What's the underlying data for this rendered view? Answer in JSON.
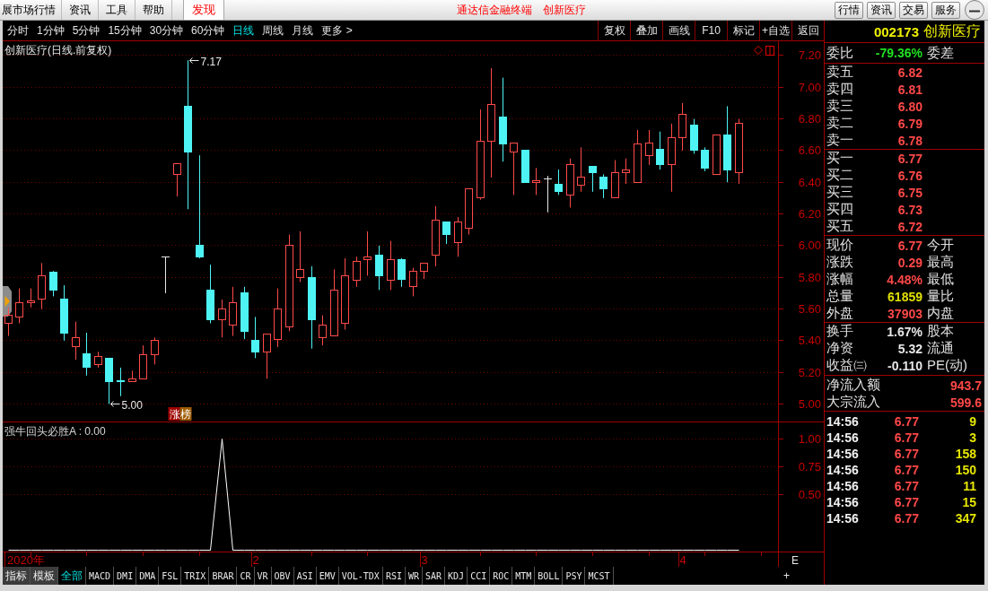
{
  "menubar": {
    "items": [
      "展市场行情",
      "资讯",
      "工具",
      "帮助"
    ],
    "discover": "发现",
    "titles": [
      "通达信金融终端",
      "创新医疗"
    ],
    "buttons": [
      "行情",
      "资讯",
      "交易",
      "服务"
    ]
  },
  "toolbar": {
    "periods": [
      {
        "label": "分时",
        "selected": false
      },
      {
        "label": "1分钟",
        "selected": false
      },
      {
        "label": "5分钟",
        "selected": false
      },
      {
        "label": "15分钟",
        "selected": false
      },
      {
        "label": "30分钟",
        "selected": false
      },
      {
        "label": "60分钟",
        "selected": false
      },
      {
        "label": "日线",
        "selected": true
      },
      {
        "label": "周线",
        "selected": false
      },
      {
        "label": "月线",
        "selected": false
      },
      {
        "label": "更多 >",
        "selected": false
      }
    ],
    "actions": [
      "复权",
      "叠加",
      "画线",
      "F10",
      "标记",
      "+自选",
      "返回"
    ]
  },
  "main_chart": {
    "chart_data": [
      {
        "type": "candlestick",
        "title": "创新医疗(日线.前复权)",
        "ylim": [
          4.89,
          7.29
        ],
        "yticks": [
          {
            "value": 5.0,
            "label": "5.00"
          },
          {
            "value": 5.2,
            "label": "5.20"
          },
          {
            "value": 5.4,
            "label": "5.40"
          },
          {
            "value": 5.6,
            "label": "5.60"
          },
          {
            "value": 5.8,
            "label": "5.80"
          },
          {
            "value": 6.0,
            "label": "6.00"
          },
          {
            "value": 6.2,
            "label": "6.20"
          },
          {
            "value": 6.4,
            "label": "6.40"
          },
          {
            "value": 6.6,
            "label": "6.60"
          },
          {
            "value": 6.8,
            "label": "6.80"
          },
          {
            "value": 7.0,
            "label": "7.00"
          },
          {
            "value": 7.2,
            "label": "7.20"
          }
        ],
        "grid": true,
        "annotations": [
          "7.17",
          "5.00",
          "涨榜"
        ],
        "ohlc": [
          [
            5.51,
            5.61,
            5.43,
            5.56
          ],
          [
            5.55,
            5.73,
            5.51,
            5.64
          ],
          [
            5.64,
            5.73,
            5.61,
            5.65
          ],
          [
            5.66,
            5.89,
            5.6,
            5.81
          ],
          [
            5.83,
            5.84,
            5.68,
            5.72
          ],
          [
            5.66,
            5.75,
            5.4,
            5.45
          ],
          [
            5.36,
            5.52,
            5.28,
            5.42
          ],
          [
            5.32,
            5.45,
            5.18,
            5.23
          ],
          [
            5.25,
            5.33,
            5.23,
            5.3
          ],
          [
            5.29,
            5.29,
            5.0,
            5.14
          ],
          [
            5.15,
            5.23,
            5.05,
            5.14
          ],
          [
            5.14,
            5.21,
            5.14,
            5.16
          ],
          [
            5.16,
            5.37,
            5.16,
            5.31
          ],
          [
            5.31,
            5.42,
            5.25,
            5.4
          ],
          [
            5.93,
            5.93,
            5.7,
            5.93
          ],
          [
            6.45,
            6.52,
            6.31,
            6.52
          ],
          [
            6.88,
            7.17,
            6.23,
            6.59
          ],
          [
            6.0,
            6.57,
            5.92,
            5.93
          ],
          [
            5.72,
            5.88,
            5.51,
            5.53
          ],
          [
            5.53,
            5.66,
            5.42,
            5.6
          ],
          [
            5.5,
            5.74,
            5.43,
            5.64
          ],
          [
            5.7,
            5.74,
            5.41,
            5.46
          ],
          [
            5.4,
            5.55,
            5.29,
            5.33
          ],
          [
            5.33,
            5.44,
            5.16,
            5.44
          ],
          [
            5.41,
            5.73,
            5.36,
            5.6
          ],
          [
            5.49,
            6.07,
            5.46,
            6.0
          ],
          [
            5.8,
            6.09,
            5.77,
            5.85
          ],
          [
            5.8,
            5.87,
            5.35,
            5.53
          ],
          [
            5.42,
            5.56,
            5.37,
            5.5
          ],
          [
            5.43,
            5.85,
            5.43,
            5.72
          ],
          [
            5.51,
            5.92,
            5.47,
            5.81
          ],
          [
            5.78,
            5.93,
            5.74,
            5.9
          ],
          [
            5.91,
            6.09,
            5.81,
            5.93
          ],
          [
            5.94,
            6.0,
            5.72,
            5.81
          ],
          [
            5.78,
            6.03,
            5.72,
            5.91
          ],
          [
            5.91,
            5.92,
            5.74,
            5.79
          ],
          [
            5.74,
            5.86,
            5.68,
            5.84
          ],
          [
            5.84,
            5.89,
            5.79,
            5.89
          ],
          [
            5.94,
            6.25,
            5.87,
            6.16
          ],
          [
            6.15,
            6.15,
            6.01,
            6.07
          ],
          [
            6.02,
            6.18,
            5.93,
            6.15
          ],
          [
            6.11,
            6.36,
            6.07,
            6.36
          ],
          [
            6.3,
            6.86,
            6.29,
            6.66
          ],
          [
            6.66,
            7.12,
            6.43,
            6.89
          ],
          [
            6.81,
            7.06,
            6.53,
            6.64
          ],
          [
            6.59,
            6.65,
            6.32,
            6.65
          ],
          [
            6.6,
            6.6,
            6.4,
            6.4
          ],
          [
            6.4,
            6.49,
            6.32,
            6.41
          ],
          [
            6.42,
            6.44,
            6.21,
            6.42
          ],
          [
            6.39,
            6.48,
            6.32,
            6.34
          ],
          [
            6.32,
            6.55,
            6.24,
            6.51
          ],
          [
            6.38,
            6.62,
            6.34,
            6.43
          ],
          [
            6.5,
            6.5,
            6.34,
            6.46
          ],
          [
            6.43,
            6.45,
            6.3,
            6.36
          ],
          [
            6.3,
            6.54,
            6.3,
            6.46
          ],
          [
            6.46,
            6.55,
            6.39,
            6.48
          ],
          [
            6.4,
            6.73,
            6.4,
            6.64
          ],
          [
            6.57,
            6.73,
            6.51,
            6.65
          ],
          [
            6.61,
            6.72,
            6.48,
            6.51
          ],
          [
            6.51,
            6.77,
            6.34,
            6.68
          ],
          [
            6.68,
            6.9,
            6.6,
            6.83
          ],
          [
            6.76,
            6.8,
            6.58,
            6.6
          ],
          [
            6.6,
            6.62,
            6.47,
            6.49
          ],
          [
            6.45,
            6.7,
            6.45,
            6.7
          ],
          [
            6.7,
            6.88,
            6.4,
            6.48
          ],
          [
            6.46,
            6.8,
            6.39,
            6.77
          ],
          null,
          null,
          null
        ]
      }
    ]
  },
  "indicator_chart": {
    "chart_data": [
      {
        "type": "line",
        "title": "强牛回头必胜A : 0.00",
        "color": "#ffffff",
        "grid": true,
        "ylim": [
          -0.0121,
          1.1573
        ],
        "yticks": [
          {
            "value": 0.5,
            "label": "0.50"
          },
          {
            "value": 0.75,
            "label": "0.75"
          },
          {
            "value": 1.0,
            "label": "1.00"
          }
        ],
        "categories": [
          null,
          null,
          null,
          null,
          null,
          null,
          null,
          null,
          null,
          null,
          null,
          null,
          null,
          null,
          null,
          null,
          null,
          null,
          null,
          null,
          null,
          null,
          "2",
          null,
          null,
          null,
          null,
          null,
          null,
          null,
          null,
          null,
          null,
          null,
          null,
          null,
          null,
          "3",
          null,
          null,
          null,
          null,
          null,
          null,
          null,
          null,
          null,
          null,
          null,
          null,
          null,
          null,
          null,
          null,
          null,
          null,
          null,
          null,
          null,
          null,
          "4",
          null,
          null,
          null,
          null,
          null,
          null,
          null,
          null
        ],
        "values": [
          0,
          0,
          0,
          0,
          0,
          0,
          0,
          0,
          0,
          0,
          0,
          0,
          0,
          0,
          0,
          0,
          0,
          0,
          0,
          1,
          0,
          0,
          0,
          0,
          0,
          0,
          0,
          0,
          0,
          0,
          0,
          0,
          0,
          0,
          0,
          0,
          0,
          0,
          0,
          0,
          0,
          0,
          0,
          0,
          0,
          0,
          0,
          0,
          0,
          0,
          0,
          0,
          0,
          0,
          0,
          0,
          0,
          0,
          0,
          0,
          0,
          0,
          0,
          0,
          0,
          0,
          null,
          null,
          null
        ]
      }
    ],
    "year_label": "2020年",
    "corner_label": "E"
  },
  "indicator_bar": {
    "tabs": [
      {
        "label": "指标",
        "kind": "menu",
        "selected": false
      },
      {
        "label": "模板",
        "kind": "menu",
        "selected": false
      },
      {
        "label": "全部",
        "kind": "tab",
        "selected": true
      },
      {
        "label": "MACD",
        "kind": "tab",
        "selected": false
      },
      {
        "label": "DMI",
        "kind": "tab",
        "selected": false
      },
      {
        "label": "DMA",
        "kind": "tab",
        "selected": false
      },
      {
        "label": "FSL",
        "kind": "tab",
        "selected": false
      },
      {
        "label": "TRIX",
        "kind": "tab",
        "selected": false
      },
      {
        "label": "BRAR",
        "kind": "tab",
        "selected": false
      },
      {
        "label": "CR",
        "kind": "tab",
        "selected": false
      },
      {
        "label": "VR",
        "kind": "tab",
        "selected": false
      },
      {
        "label": "OBV",
        "kind": "tab",
        "selected": false
      },
      {
        "label": "ASI",
        "kind": "tab",
        "selected": false
      },
      {
        "label": "EMV",
        "kind": "tab",
        "selected": false
      },
      {
        "label": "VOL-TDX",
        "kind": "tab",
        "selected": false
      },
      {
        "label": "RSI",
        "kind": "tab",
        "selected": false
      },
      {
        "label": "WR",
        "kind": "tab",
        "selected": false
      },
      {
        "label": "SAR",
        "kind": "tab",
        "selected": false
      },
      {
        "label": "KDJ",
        "kind": "tab",
        "selected": false
      },
      {
        "label": "CCI",
        "kind": "tab",
        "selected": false
      },
      {
        "label": "ROC",
        "kind": "tab",
        "selected": false
      },
      {
        "label": "MTM",
        "kind": "tab",
        "selected": false
      },
      {
        "label": "BOLL",
        "kind": "tab",
        "selected": false
      },
      {
        "label": "PSY",
        "kind": "tab",
        "selected": false
      },
      {
        "label": "MCST",
        "kind": "tab",
        "selected": false
      }
    ],
    "add_button": "+"
  },
  "quote_panel": {
    "code": "002173",
    "name": "创新医疗",
    "summary": [
      {
        "label": "委比",
        "value": "-79.36%",
        "color": "#20e020",
        "label2": "委差"
      }
    ],
    "asks": [
      {
        "label": "卖五",
        "value": "6.82",
        "color": "#ff4848"
      },
      {
        "label": "卖四",
        "value": "6.81",
        "color": "#ff4848"
      },
      {
        "label": "卖三",
        "value": "6.80",
        "color": "#ff4848"
      },
      {
        "label": "卖二",
        "value": "6.79",
        "color": "#ff4848"
      },
      {
        "label": "卖一",
        "value": "6.78",
        "color": "#ff4848"
      }
    ],
    "bids": [
      {
        "label": "买一",
        "value": "6.77",
        "color": "#ff4848"
      },
      {
        "label": "买二",
        "value": "6.76",
        "color": "#ff4848"
      },
      {
        "label": "买三",
        "value": "6.75",
        "color": "#ff4848"
      },
      {
        "label": "买四",
        "value": "6.73",
        "color": "#ff4848"
      },
      {
        "label": "买五",
        "value": "6.72",
        "color": "#ff4848"
      }
    ],
    "quote": [
      {
        "label": "现价",
        "value": "6.77",
        "color": "#ff4848",
        "label2": "今开"
      },
      {
        "label": "涨跌",
        "value": "0.29",
        "color": "#ff4848",
        "label2": "最高"
      },
      {
        "label": "涨幅",
        "value": "4.48%",
        "color": "#ff4848",
        "label2": "最低"
      },
      {
        "label": "总量",
        "value": "61859",
        "color": "#e0e000",
        "label2": "量比"
      },
      {
        "label": "外盘",
        "value": "37903",
        "color": "#ff4848",
        "label2": "内盘"
      }
    ],
    "finance": [
      {
        "label": "换手",
        "value": "1.67%",
        "color": "#e8e8e8",
        "label2": "股本"
      },
      {
        "label": "净资",
        "value": "5.32",
        "color": "#e8e8e8",
        "label2": "流通"
      },
      {
        "label": "收益㈢",
        "value": "-0.110",
        "color": "#e8e8e8",
        "label2": "PE(动)"
      }
    ],
    "flows": [
      {
        "label": "净流入额",
        "value": "943.7",
        "color": "#ff4848"
      },
      {
        "label": "大宗流入",
        "value": "599.6",
        "color": "#ff4848"
      }
    ],
    "ticks": [
      {
        "time": "14:56",
        "price": "6.77",
        "color": "#ff4848",
        "volume": "9"
      },
      {
        "time": "14:56",
        "price": "6.77",
        "color": "#ff4848",
        "volume": "3"
      },
      {
        "time": "14:56",
        "price": "6.77",
        "color": "#ff4848",
        "volume": "158"
      },
      {
        "time": "14:56",
        "price": "6.77",
        "color": "#ff4848",
        "volume": "150"
      },
      {
        "time": "14:56",
        "price": "6.77",
        "color": "#ff4848",
        "volume": "11"
      },
      {
        "time": "14:56",
        "price": "6.77",
        "color": "#ff4848",
        "volume": "15"
      },
      {
        "time": "14:56",
        "price": "6.77",
        "color": "#ff4848",
        "volume": "347"
      }
    ]
  }
}
